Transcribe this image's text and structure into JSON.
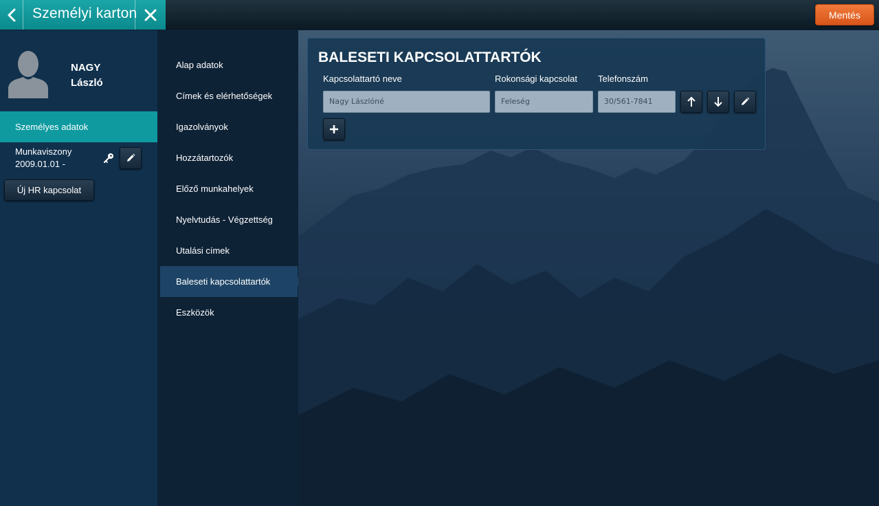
{
  "header": {
    "title": "Személyi karton",
    "back_icon": "chevron-left-icon",
    "close_icon": "close-icon",
    "save_label": "Mentés"
  },
  "person": {
    "last_name": "NAGY",
    "first_name": "László",
    "avatar_icon": "person-silhouette-icon"
  },
  "left_panel": {
    "active_item": "Személyes adatok",
    "employment_label": "Munkaviszony",
    "employment_date": "2009.01.01 -",
    "new_hr_label": "Új HR kapcsolat"
  },
  "nav": {
    "items": [
      {
        "label": "Alap adatok"
      },
      {
        "label": "Címek és elérhetőségek"
      },
      {
        "label": "Igazolványok"
      },
      {
        "label": "Hozzátartozók"
      },
      {
        "label": "Előző munkahelyek"
      },
      {
        "label": "Nyelvtudás - Végzettség"
      },
      {
        "label": "Utalási címek"
      },
      {
        "label": "Baleseti kapcsolattartók"
      },
      {
        "label": "Eszközök"
      }
    ],
    "active_index": 7
  },
  "card": {
    "title": "BALESETI KAPCSOLATTARTÓK",
    "columns": {
      "name": "Kapcsolattartó neve",
      "relation": "Rokonsági kapcsolat",
      "phone": "Telefonszám"
    },
    "row": {
      "name": "Nagy Lászlóné",
      "relation": "Feleség",
      "phone": "30/561-7841"
    }
  },
  "colors": {
    "accent_teal": "#0f9aa0",
    "save_orange": "#e8642a",
    "nav_active": "#1d4466"
  }
}
